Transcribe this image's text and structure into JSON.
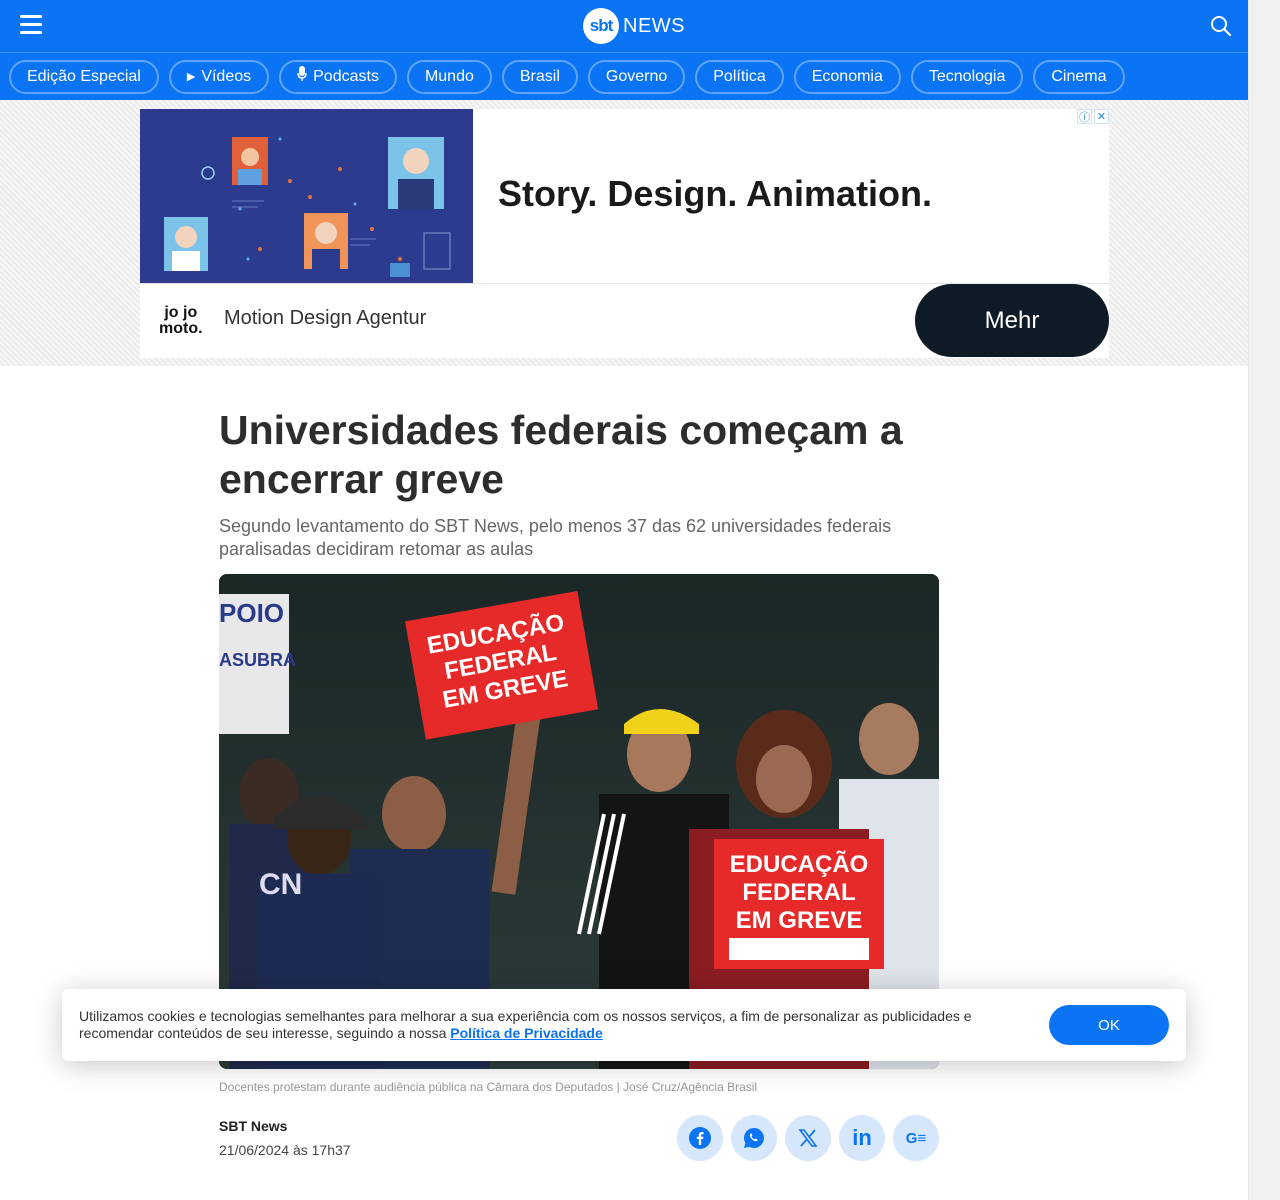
{
  "header": {
    "logo_mark": "sbt",
    "logo_text": "NEWS",
    "menu_icon": "hamburger-icon",
    "search_icon": "search-icon",
    "brand_color": "#0a74f4"
  },
  "nav": {
    "items": [
      {
        "label": "Edição Especial"
      },
      {
        "label": "Vídeos",
        "icon": "play-icon"
      },
      {
        "label": "Podcasts",
        "icon": "microphone-icon"
      },
      {
        "label": "Mundo"
      },
      {
        "label": "Brasil"
      },
      {
        "label": "Governo"
      },
      {
        "label": "Política"
      },
      {
        "label": "Economia"
      },
      {
        "label": "Tecnologia"
      },
      {
        "label": "Cinema"
      }
    ]
  },
  "ad": {
    "headline": "Story. Design. Animation.",
    "brand_line1": "jo jo",
    "brand_line2": "moto.",
    "subtitle": "Motion Design Agentur",
    "cta": "Mehr",
    "info_glyph": "ⓘ",
    "close_glyph": "✕"
  },
  "article": {
    "headline": "Universidades federais começam a encerrar greve",
    "subtitle": "Segundo levantamento do SBT News, pelo menos 37 das 62 universidades federais paralisadas decidiram retomar as aulas",
    "image": {
      "sign1_line1": "EDUCAÇÃO",
      "sign1_line2": "FEDERAL",
      "sign1_line3": "EM GREVE",
      "sign2_line1": "EDUCAÇÃO",
      "sign2_line2": "FEDERAL",
      "sign2_line3": "EM GREVE"
    },
    "caption": "Docentes protestam durante audiência pública na Câmara dos Deputados | José Cruz/Agência Brasil",
    "author": "SBT News",
    "date": "21/06/2024 às 17h37",
    "share": [
      "facebook-icon",
      "whatsapp-icon",
      "x-icon",
      "linkedin-icon",
      "google-news-icon"
    ],
    "share_linkedin_text": "in",
    "share_gnews_text": "G≡"
  },
  "cookie": {
    "text": "Utilizamos cookies e tecnologias semelhantes para melhorar a sua experiência com os nossos serviços, a fim de personalizar as publicidades e recomendar conteúdos de seu interesse, seguindo a nossa ",
    "link": "Política de Privacidade",
    "ok": "OK"
  }
}
